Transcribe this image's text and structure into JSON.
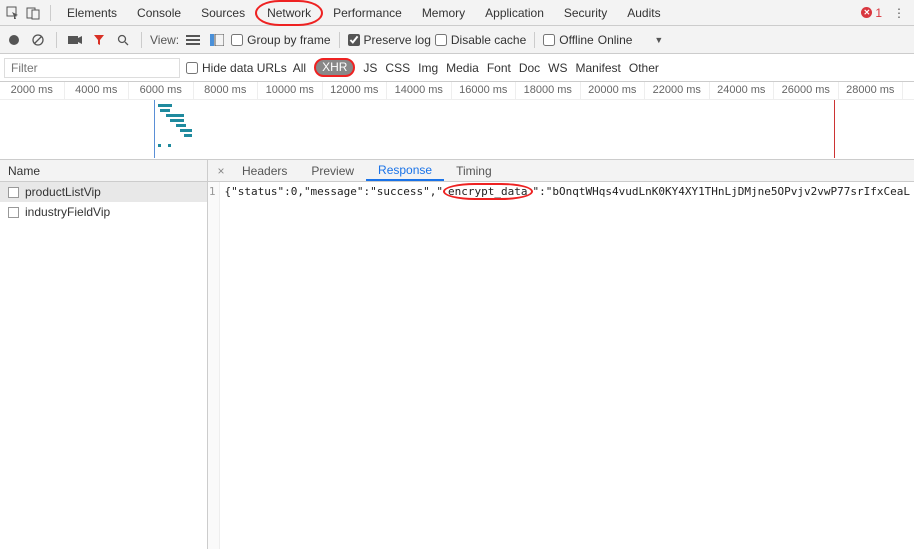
{
  "top": {
    "tabs": [
      "Elements",
      "Console",
      "Sources",
      "Network",
      "Performance",
      "Memory",
      "Application",
      "Security",
      "Audits"
    ],
    "error_count": "1"
  },
  "toolbar": {
    "view_label": "View:",
    "group_by_frame": "Group by frame",
    "preserve_log": "Preserve log",
    "disable_cache": "Disable cache",
    "offline": "Offline",
    "online_label": "Online"
  },
  "filter": {
    "placeholder": "Filter",
    "hide_data_urls": "Hide data URLs",
    "types": [
      "All",
      "XHR",
      "JS",
      "CSS",
      "Img",
      "Media",
      "Font",
      "Doc",
      "WS",
      "Manifest",
      "Other"
    ]
  },
  "timeline": {
    "ticks": [
      "2000 ms",
      "4000 ms",
      "6000 ms",
      "8000 ms",
      "10000 ms",
      "12000 ms",
      "14000 ms",
      "16000 ms",
      "18000 ms",
      "20000 ms",
      "22000 ms",
      "24000 ms",
      "26000 ms",
      "28000 ms"
    ]
  },
  "requests": {
    "header": "Name",
    "items": [
      "productListVip",
      "industryFieldVip"
    ]
  },
  "detail": {
    "tabs": [
      "Headers",
      "Preview",
      "Response",
      "Timing"
    ],
    "line_no": "1",
    "resp_pre": "{\"status\":0,\"message\":\"success\",\"",
    "resp_hl": "encrypt_data",
    "resp_post": "\":\"bOnqtWHqs4vudLnK0KY4XY1THnLjDMjne5OPvjv2vwP77srIfxCeaL"
  }
}
